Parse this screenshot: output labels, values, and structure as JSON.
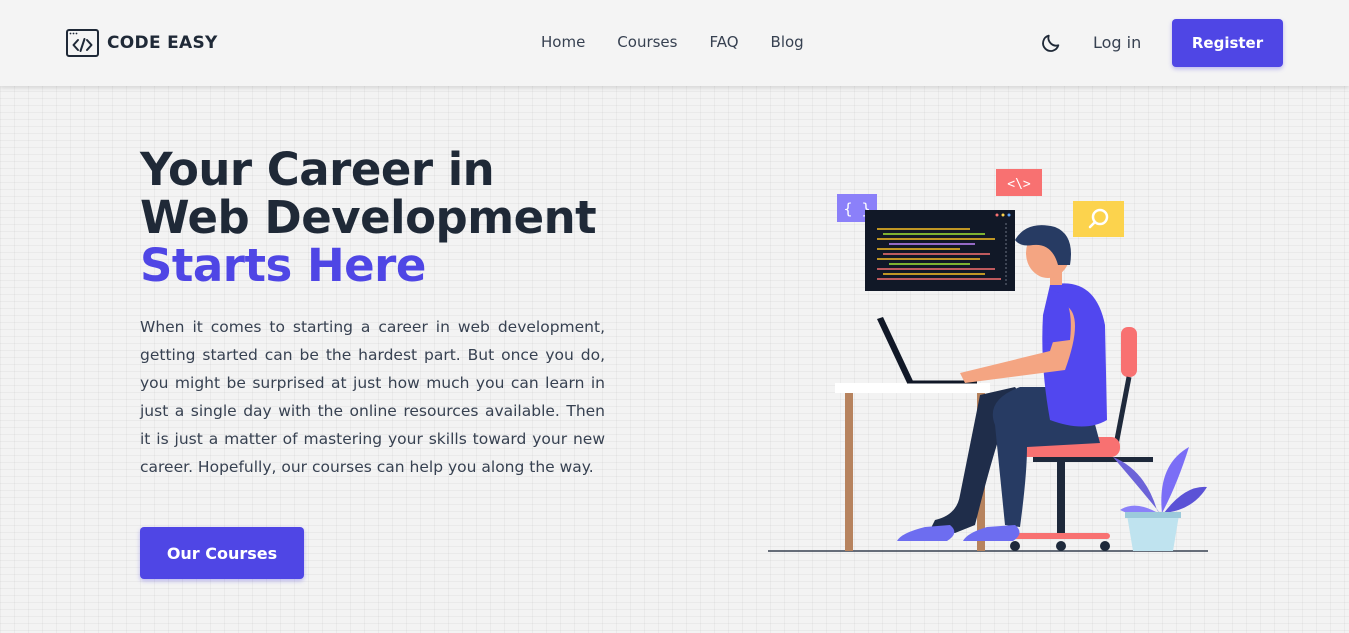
{
  "navbar": {
    "brand": {
      "icon": "code-icon",
      "name": "CODE EASY"
    },
    "links": [
      "Home",
      "Courses",
      "FAQ",
      "Blog"
    ],
    "theme_toggle_icon": "moon-icon",
    "login_label": "Log in",
    "register_label": "Register"
  },
  "hero": {
    "title_line1": "Your Career in",
    "title_line2": "Web Development",
    "title_accent": "Starts Here",
    "description": "When it comes to starting a career in web development, getting started can be the hardest part. But once you do, you might be surprised at just how much you can learn in just a single day with the online resources available. Then it is just a matter of mastering your skills toward your new career. Hopefully, our courses can help you along the way.",
    "cta_label": "Our Courses"
  },
  "illustration": {
    "tag_braces": "{ }",
    "tag_code": "<\\>"
  },
  "colors": {
    "accent": "#4f46e5",
    "dark_text": "#1f2937",
    "body_text": "#374151",
    "background": "#f3f3f3"
  }
}
